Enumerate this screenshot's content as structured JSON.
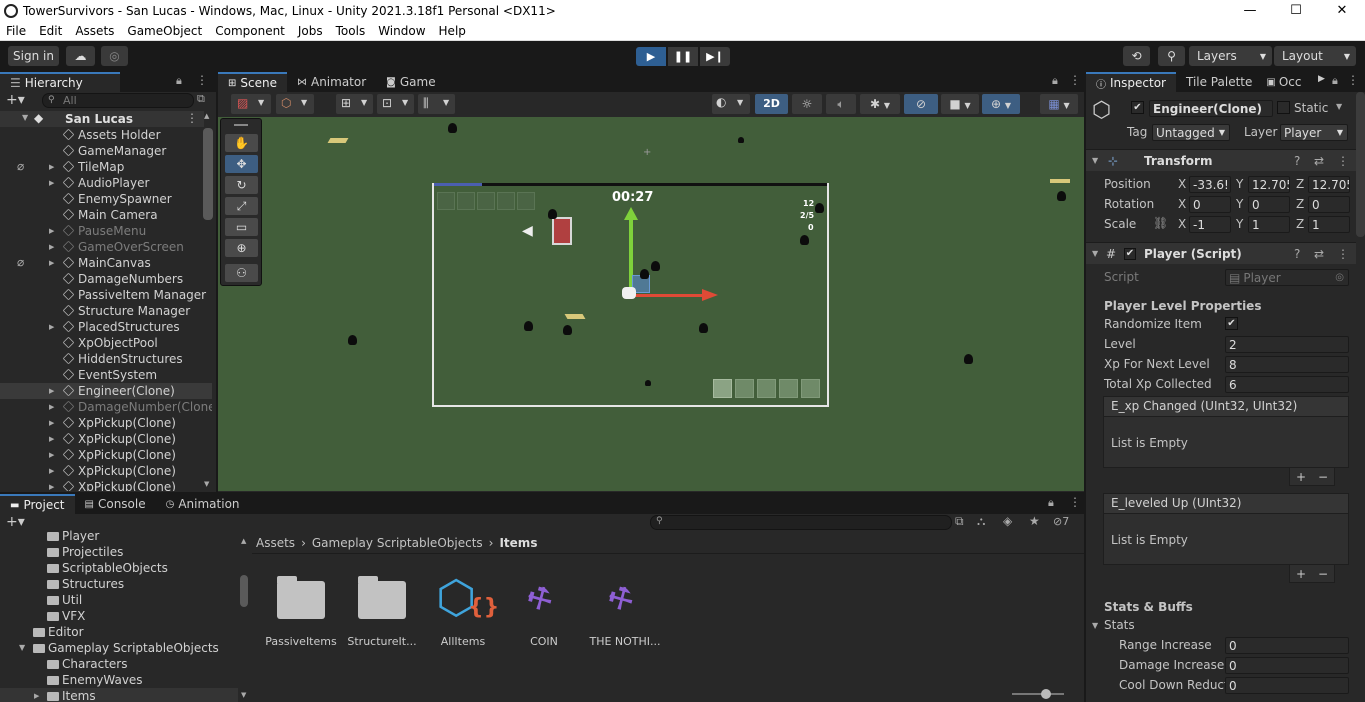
{
  "window": {
    "title": "TowerSurvivors - San Lucas - Windows, Mac, Linux - Unity 2021.3.18f1 Personal <DX11>",
    "min": "—",
    "max": "☐",
    "close": "✕"
  },
  "menu": [
    "File",
    "Edit",
    "Assets",
    "GameObject",
    "Component",
    "Jobs",
    "Tools",
    "Window",
    "Help"
  ],
  "toolbar": {
    "sign_in": "Sign in",
    "layers": "Layers",
    "layout": "Layout"
  },
  "hierarchy": {
    "tab": "Hierarchy",
    "search_placeholder": "All",
    "scene_name": "San Lucas",
    "items": [
      {
        "label": "Assets Holder",
        "expandable": false,
        "dim": false
      },
      {
        "label": "GameManager",
        "expandable": false,
        "dim": false
      },
      {
        "label": "TileMap",
        "expandable": true,
        "dim": false
      },
      {
        "label": "AudioPlayer",
        "expandable": true,
        "dim": false
      },
      {
        "label": "EnemySpawner",
        "expandable": false,
        "dim": false
      },
      {
        "label": "Main Camera",
        "expandable": false,
        "dim": false
      },
      {
        "label": "PauseMenu",
        "expandable": true,
        "dim": true
      },
      {
        "label": "GameOverScreen",
        "expandable": true,
        "dim": true
      },
      {
        "label": "MainCanvas",
        "expandable": true,
        "dim": false
      },
      {
        "label": "DamageNumbers",
        "expandable": false,
        "dim": false
      },
      {
        "label": "PassiveItem Manager",
        "expandable": false,
        "dim": false
      },
      {
        "label": "Structure Manager",
        "expandable": false,
        "dim": false
      },
      {
        "label": "PlacedStructures",
        "expandable": true,
        "dim": false
      },
      {
        "label": "XpObjectPool",
        "expandable": false,
        "dim": false
      },
      {
        "label": "HiddenStructures",
        "expandable": false,
        "dim": false
      },
      {
        "label": "EventSystem",
        "expandable": false,
        "dim": false
      },
      {
        "label": "Engineer(Clone)",
        "expandable": true,
        "dim": false
      },
      {
        "label": "DamageNumber(Clone",
        "expandable": true,
        "dim": true
      },
      {
        "label": "XpPickup(Clone)",
        "expandable": true,
        "dim": false
      },
      {
        "label": "XpPickup(Clone)",
        "expandable": true,
        "dim": false
      },
      {
        "label": "XpPickup(Clone)",
        "expandable": true,
        "dim": false
      },
      {
        "label": "XpPickup(Clone)",
        "expandable": true,
        "dim": false
      },
      {
        "label": "XpPickup(Clone)",
        "expandable": true,
        "dim": false
      }
    ]
  },
  "scene": {
    "tabs": [
      "Scene",
      "Animator",
      "Game"
    ],
    "mode_2d": "2D",
    "hud": {
      "timer": "00:27",
      "count1": "12",
      "count2": "2/5",
      "count3": "0"
    }
  },
  "inspector": {
    "tabs": [
      "Inspector",
      "Tile Palette",
      "Occ"
    ],
    "object_name": "Engineer(Clone)",
    "static_label": "Static",
    "tag_label": "Tag",
    "tag_value": "Untagged",
    "layer_label": "Layer",
    "layer_value": "Player",
    "transform": {
      "title": "Transform",
      "position": {
        "label": "Position",
        "x": "-33.6!",
        "y": "12.705",
        "z": "12.705"
      },
      "rotation": {
        "label": "Rotation",
        "x": "0",
        "y": "0",
        "z": "0"
      },
      "scale": {
        "label": "Scale",
        "x": "-1",
        "y": "1",
        "z": "1"
      }
    },
    "player_script": {
      "title": "Player (Script)",
      "script_label": "Script",
      "script_value": "Player",
      "section": "Player Level Properties",
      "randomize_label": "Randomize Item",
      "level_label": "Level",
      "level_value": "2",
      "xp_next_label": "Xp For Next Level",
      "xp_next_value": "8",
      "total_xp_label": "Total Xp Collected",
      "total_xp_value": "6",
      "event1_title": "E_xp Changed (UInt32, UInt32)",
      "event1_empty": "List is Empty",
      "event2_title": "E_leveled Up (UInt32)",
      "event2_empty": "List is Empty",
      "stats_section": "Stats & Buffs",
      "stats_fold": "Stats",
      "stats": [
        {
          "label": "Range Increase",
          "value": "0"
        },
        {
          "label": "Damage Increase",
          "value": "0"
        },
        {
          "label": "Cool Down Reduct",
          "value": "0"
        }
      ]
    }
  },
  "project": {
    "tabs": [
      "Project",
      "Console",
      "Animation"
    ],
    "badge": "7",
    "tree": [
      {
        "label": "Player",
        "indent": 2
      },
      {
        "label": "Projectiles",
        "indent": 2
      },
      {
        "label": "ScriptableObjects",
        "indent": 2
      },
      {
        "label": "Structures",
        "indent": 2
      },
      {
        "label": "Util",
        "indent": 2
      },
      {
        "label": "VFX",
        "indent": 2
      },
      {
        "label": "Editor",
        "indent": 1
      },
      {
        "label": "Gameplay ScriptableObjects",
        "indent": 1
      },
      {
        "label": "Characters",
        "indent": 2
      },
      {
        "label": "EnemyWaves",
        "indent": 2
      },
      {
        "label": "Items",
        "indent": 2
      }
    ],
    "breadcrumb": [
      "Assets",
      "Gameplay ScriptableObjects",
      "Items"
    ],
    "assets": [
      "PassiveItems",
      "StructureIt...",
      "AllItems",
      "COIN",
      "THE NOTHI..."
    ]
  },
  "colors": {
    "accent": "#3a79bb",
    "scene_bg": "#425e3a",
    "panel": "#282828",
    "gizmo_y": "#7fd13b",
    "gizmo_x": "#e04a36"
  }
}
